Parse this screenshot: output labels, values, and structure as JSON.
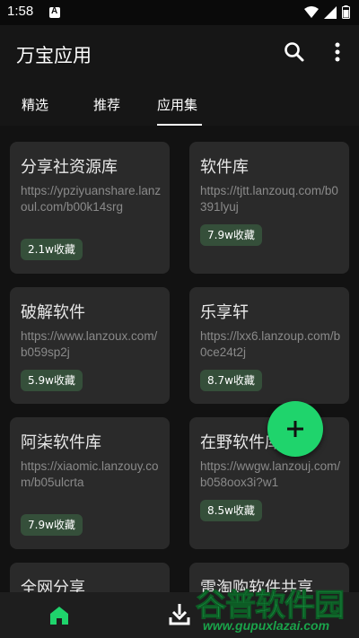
{
  "status_bar": {
    "time": "1:58"
  },
  "app_bar": {
    "title": "万宝应用"
  },
  "tabs": [
    {
      "label": "精选"
    },
    {
      "label": "推荐"
    },
    {
      "label": "应用集"
    }
  ],
  "cards": [
    {
      "title": "分享社资源库",
      "url": "https://ypziyuanshare.lanzoul.com/b00k14srg",
      "favorites": "2.1w收藏"
    },
    {
      "title": "软件库",
      "url": "https://tjtt.lanzouq.com/b0391lyuj",
      "favorites": "7.9w收藏"
    },
    {
      "title": "破解软件",
      "url": "https://www.lanzoux.com/b059sp2j",
      "favorites": "5.9w收藏"
    },
    {
      "title": "乐享轩",
      "url": "https://lxx6.lanzoup.com/b0ce24t2j",
      "favorites": "8.7w收藏"
    },
    {
      "title": "阿柒软件库",
      "url": "https://xiaomic.lanzouy.com/b05ulcrta",
      "favorites": "7.9w收藏"
    },
    {
      "title": "在野软件库",
      "url": "https://wwgw.lanzouj.com/b058oox3i?w1",
      "favorites": "8.5w收藏"
    },
    {
      "title": "全网分享",
      "url": "",
      "favorites": ""
    },
    {
      "title": "雷淘购软件共享",
      "url": "",
      "favorites": ""
    }
  ],
  "icons": {
    "search": "search-icon",
    "more": "more-vert-icon",
    "fab": "add-icon",
    "home": "home-icon",
    "download": "download-icon"
  },
  "colors": {
    "accent": "#1fd46c",
    "badge_bg": "#354f3a",
    "card_bg": "#2a2a2a",
    "background": "#121212"
  },
  "watermark": {
    "logo": "谷普软件园",
    "url": "www.gupuxlazai.com"
  }
}
